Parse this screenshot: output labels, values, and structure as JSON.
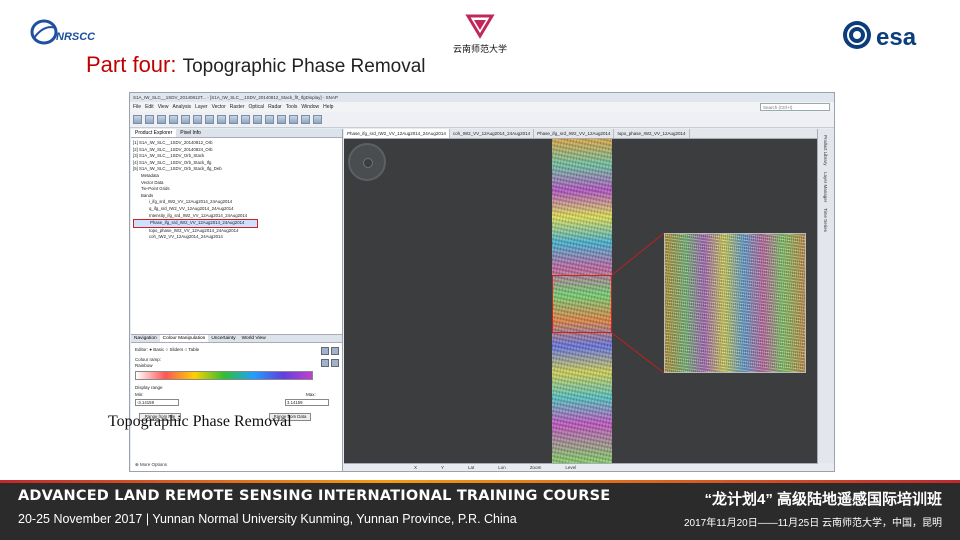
{
  "header": {
    "logo_left_text": "NRSCC",
    "logo_center_text": "云南师范大学",
    "logo_right_text": "esa",
    "title_prefix": "Part four:",
    "title_main": "Topographic Phase Removal"
  },
  "app": {
    "title": "S1A_IW_SLC__1SDV_20140812T... - [S1A_IW_SLC__1SDV_20140812_Stack_flt_IfgDisplay] - SNAP",
    "menu": [
      "File",
      "Edit",
      "View",
      "Analysis",
      "Layer",
      "Vector",
      "Raster",
      "Optical",
      "Radar",
      "Tools",
      "Window",
      "Help"
    ],
    "search_placeholder": "Search (Ctrl+I)",
    "left_tabs": [
      "Product Explorer",
      "Pixel Info"
    ],
    "tree_items": [
      "[1] S1A_IW_SLC__1SDV_20140812_Orb",
      "[2] S1A_IW_SLC__1SDV_20140824_Orb",
      "[3] S1A_IW_SLC__1SDV_Orb_Stack",
      "[4] S1A_IW_SLC__1SDV_Orb_Stack_Ifg",
      "[5] S1A_IW_SLC__1SDV_Orb_Stack_Ifg_Deb",
      "Metadata",
      "Vector Data",
      "Tie-Point Grids",
      "Bands",
      "i_ifg_srd_IW2_VV_12Aug2014_24Aug2014",
      "q_ifg_srd_IW2_VV_12Aug2014_24Aug2014",
      "Intensity_ifg_srd_IW2_VV_12Aug2014_24Aug2014",
      "Phase_ifg_srd_IW2_VV_12Aug2014_24Aug2014",
      "topo_phase_IW2_VV_12Aug2014_24Aug2014",
      "coh_IW2_VV_12Aug2014_24Aug2014"
    ],
    "selected_tree_index": 12,
    "bottom_tabs": [
      "Navigation",
      "Colour Manipulation",
      "Uncertainty",
      "World View"
    ],
    "colour": {
      "editor_label": "Editor:",
      "mode_basic": "Basic",
      "mode_sliders": "Sliders",
      "mode_table": "Table",
      "palette_label": "Colour ramp:",
      "palette_value": "Rainbow",
      "range_label": "Display range",
      "min_label": "Min:",
      "max_label": "Max:",
      "min_value": "-3.14159",
      "max_value": "3.14159",
      "range_from_file": "Range from File",
      "range_from_data": "Range from Data",
      "more_options": "More Options"
    },
    "image_tabs": [
      "Phase_ifg_srd_IW2_VV_12Aug2014_24Aug2014",
      "coh_IW2_VV_12Aug2014_24Aug2014",
      "Phase_ifg_srd_IW2_VV_12Aug2014",
      "topo_phase_IW2_VV_12Aug2014"
    ],
    "right_sidebar": [
      "Product Library",
      "Layer Manager",
      "Time Series"
    ],
    "status": [
      "X",
      "Y",
      "Lat",
      "Lon",
      "Zoom",
      "Level"
    ]
  },
  "overlay_caption": "Topographic Phase Removal",
  "footer": {
    "left_line1": "ADVANCED LAND REMOTE SENSING INTERNATIONAL TRAINING COURSE",
    "left_line2": "20-25 November 2017 | Yunnan Normal University Kunming, Yunnan Province, P.R. China",
    "right_line1": "“龙计划4” 高级陆地遥感国际培训班",
    "right_line2": "2017年11月20日——11月25日   云南师范大学，中国，昆明"
  }
}
